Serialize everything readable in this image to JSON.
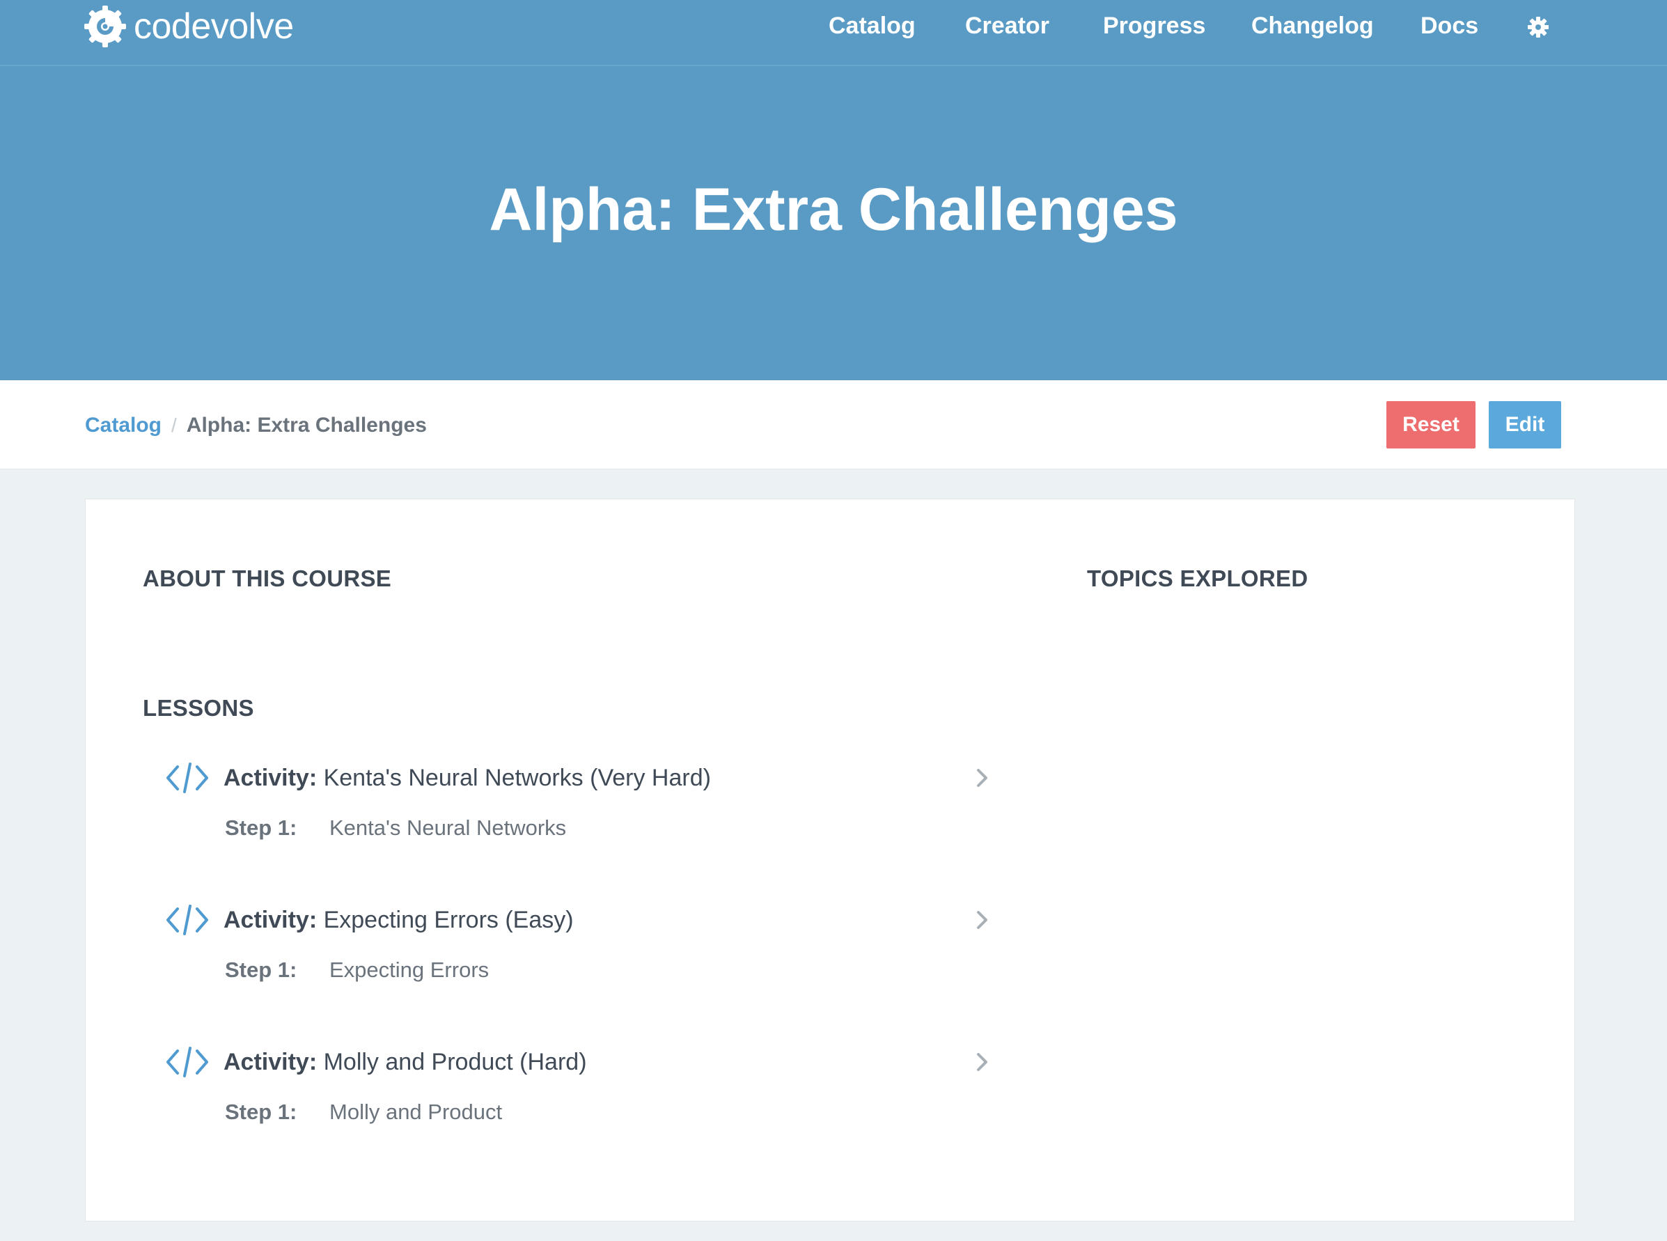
{
  "nav": {
    "brand": "codevolve",
    "links": [
      "Catalog",
      "Creator",
      "Progress",
      "Changelog",
      "Docs"
    ],
    "settings_icon": "gear-icon"
  },
  "hero": {
    "title": "Alpha: Extra Challenges"
  },
  "breadcrumb": {
    "root": "Catalog",
    "separator": "/",
    "current": "Alpha: Extra Challenges"
  },
  "actions": {
    "reset_label": "Reset",
    "edit_label": "Edit"
  },
  "sections": {
    "about": "ABOUT THIS COURSE",
    "topics": "TOPICS EXPLORED",
    "lessons": "LESSONS"
  },
  "lessons": [
    {
      "kind": "Activity:",
      "title": "Kenta's Neural Networks (Very Hard)",
      "step_label": "Step 1:",
      "step_name": "Kenta's Neural Networks"
    },
    {
      "kind": "Activity:",
      "title": "Expecting Errors (Easy)",
      "step_label": "Step 1:",
      "step_name": "Expecting Errors"
    },
    {
      "kind": "Activity:",
      "title": "Molly and Product (Hard)",
      "step_label": "Step 1:",
      "step_name": "Molly and Product"
    }
  ],
  "colors": {
    "header_bg": "#5a9bc5",
    "reset": "#ee6d6e",
    "edit": "#5aa8dc",
    "link": "#4f9bd1",
    "page_bg": "#ecf1f4"
  }
}
